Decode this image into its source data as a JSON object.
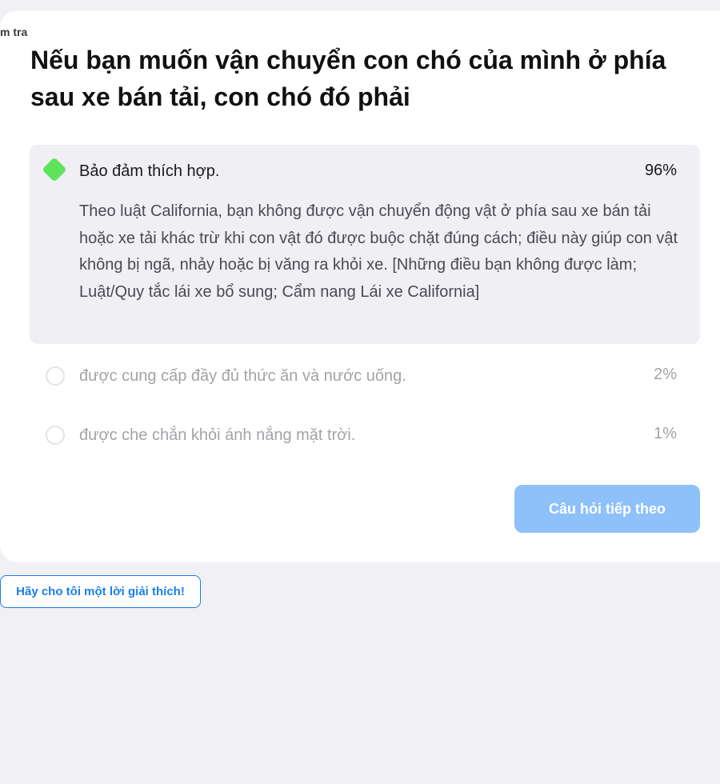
{
  "breadcrumb": {
    "fragment": "m tra"
  },
  "question": {
    "text": "Nếu bạn muốn vận chuyển con chó của mình ở phía sau xe bán tải, con chó đó phải"
  },
  "answers": [
    {
      "label": "Bảo đảm thích hợp.",
      "percent": "96%",
      "correct": true,
      "indicator_icon": "green-diamond-icon",
      "explanation": "Theo luật California, bạn không được vận chuyển động vật ở phía sau xe bán tải hoặc xe tải khác trừ khi con vật đó được buộc chặt đúng cách; điều này giúp con vật không bị ngã, nhảy hoặc bị văng ra khỏi xe. [Những điều bạn không được làm; Luật/Quy tắc lái xe bổ sung; Cẩm nang Lái xe California]"
    },
    {
      "label": "được cung cấp đầy đủ thức ăn và nước uống.",
      "percent": "2%",
      "correct": false,
      "indicator_icon": "radio-circle-icon"
    },
    {
      "label": "được che chắn khỏi ánh nắng mặt trời.",
      "percent": "1%",
      "correct": false,
      "indicator_icon": "radio-circle-icon"
    }
  ],
  "buttons": {
    "next_label": "Câu hỏi tiếp theo",
    "explain_label": "Hãy cho tôi một lời giải thích!"
  },
  "colors": {
    "page_background": "#f0f0f5",
    "correct_answer_background": "#efeff4",
    "correct_indicator": "#5ee35a",
    "next_button": "#8ec0fa",
    "link_blue": "#1b7fe6",
    "muted_text": "#a3a3a8"
  }
}
